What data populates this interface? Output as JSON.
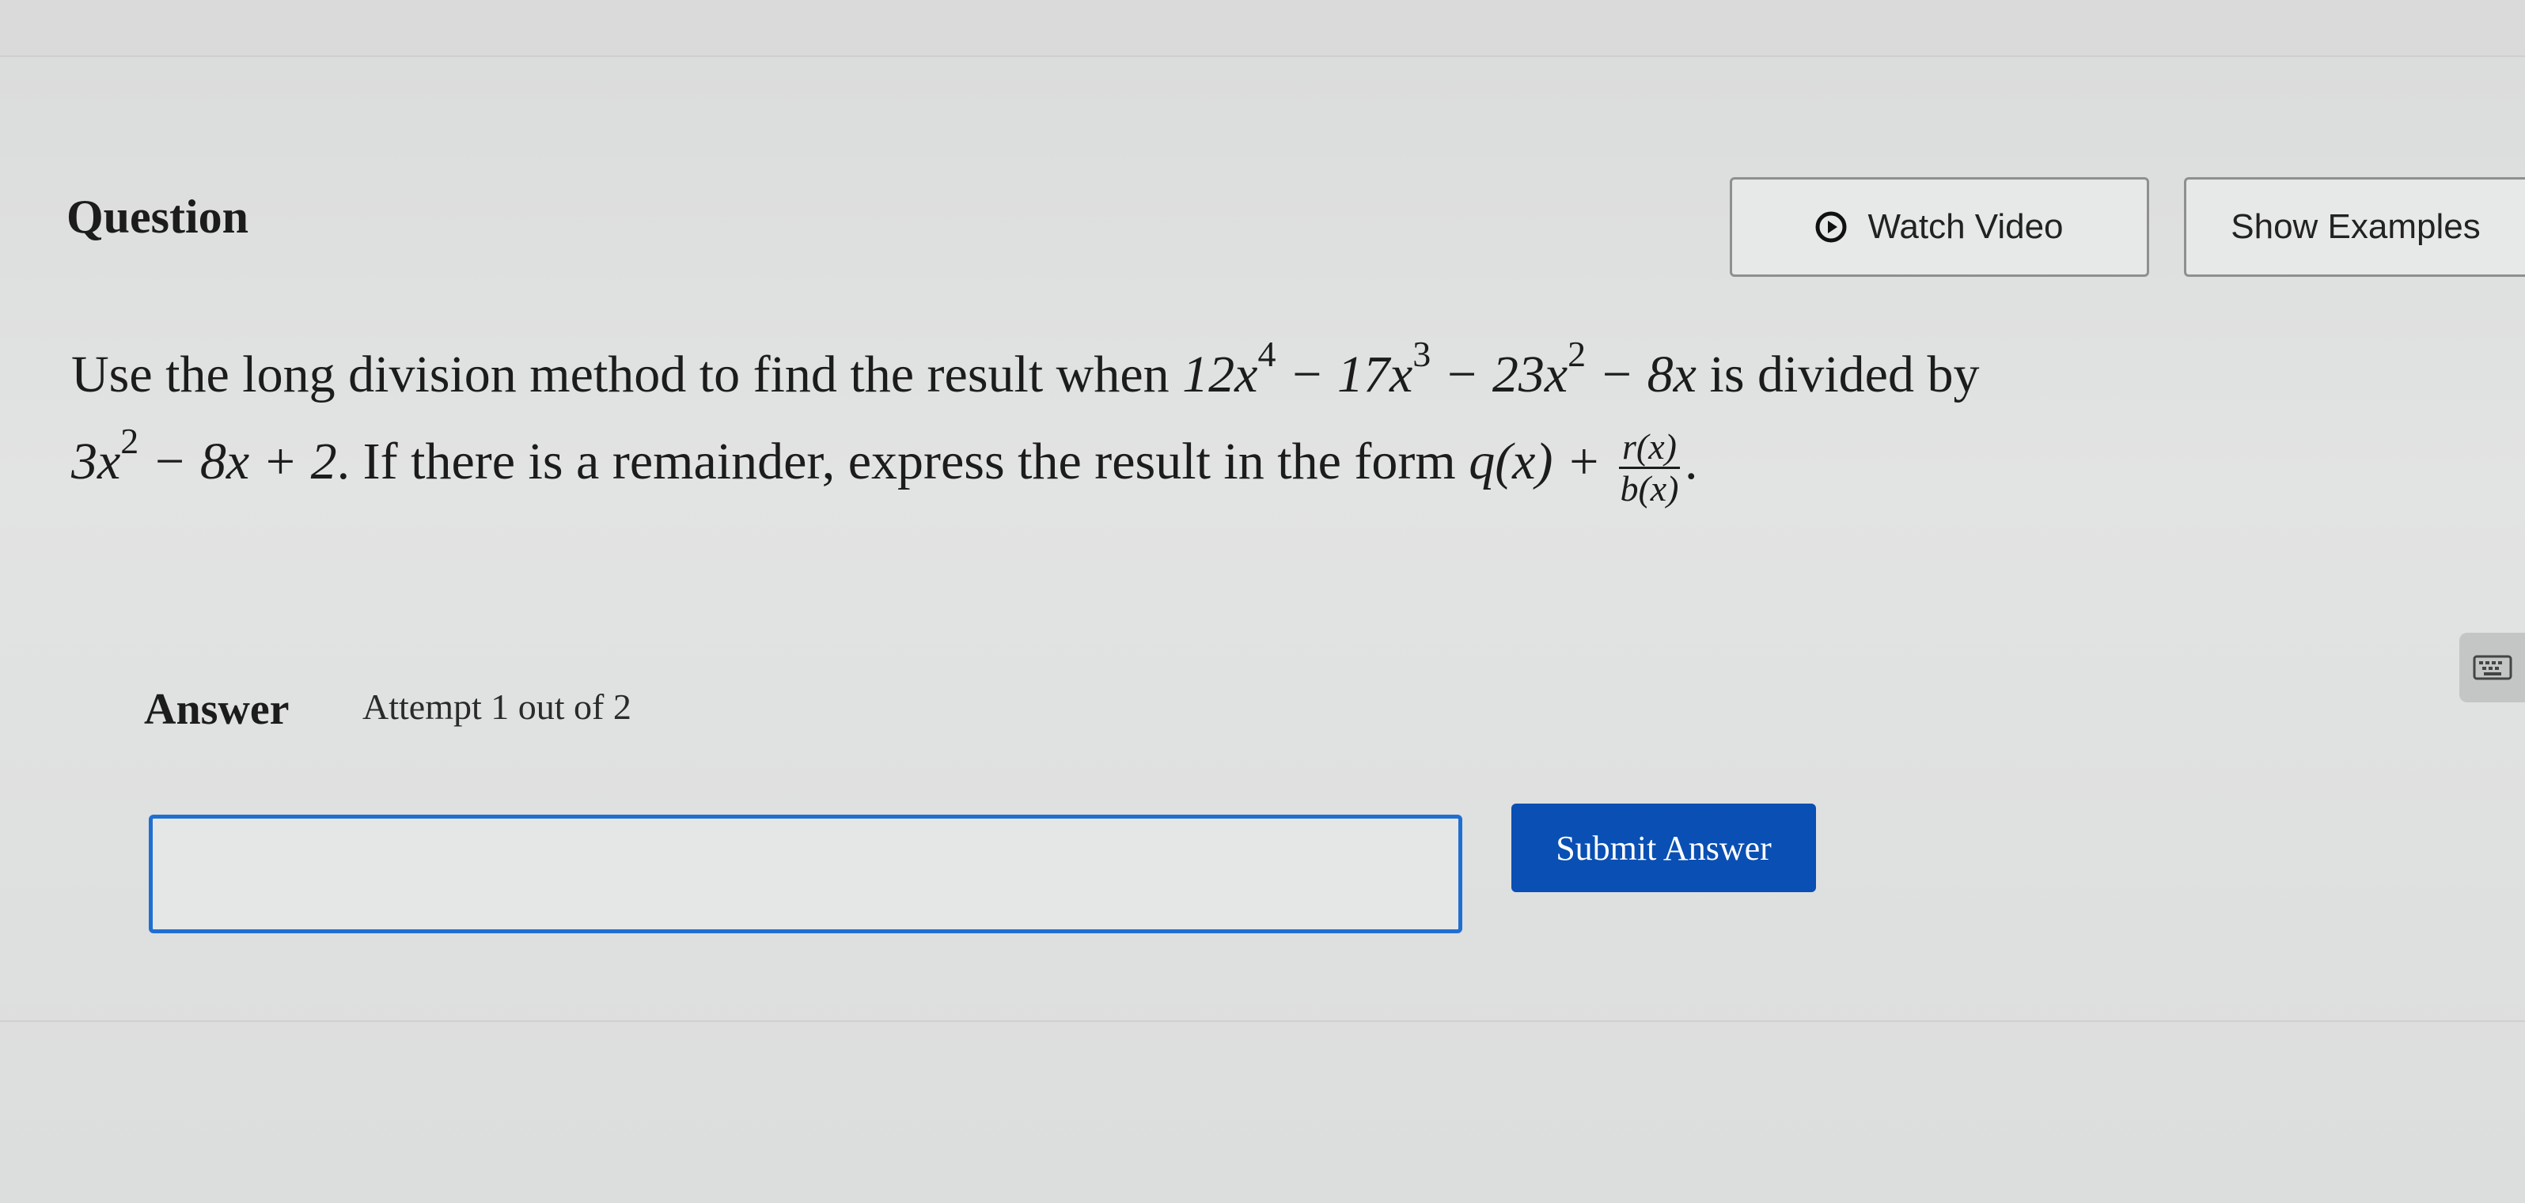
{
  "question": {
    "title": "Question",
    "watch_video_label": "Watch Video",
    "show_examples_label": "Show Examples"
  },
  "problem": {
    "intro": "Use the long division method to find the result when ",
    "dividend": {
      "t1": "12x",
      "e1": "4",
      "t2": " − 17x",
      "e2": "3",
      "t3": " − 23x",
      "e3": "2",
      "t4": " − 8x"
    },
    "mid": " is divided by",
    "divisor": {
      "t1": "3x",
      "e1": "2",
      "t2": " − 8x + 2"
    },
    "tail": ". If there is a remainder, express the result in the form ",
    "form_q": "q(x) + ",
    "form_num": "r(x)",
    "form_den": "b(x)",
    "end": "."
  },
  "answer": {
    "label": "Answer",
    "attempt": "Attempt 1 out of 2",
    "input_value": "",
    "submit_label": "Submit Answer"
  },
  "colors": {
    "accent": "#0a4fb3",
    "input_border": "#1f6fd1",
    "background": "#dedfdf"
  },
  "icons": [
    "play-circle-icon",
    "keyboard-icon"
  ]
}
